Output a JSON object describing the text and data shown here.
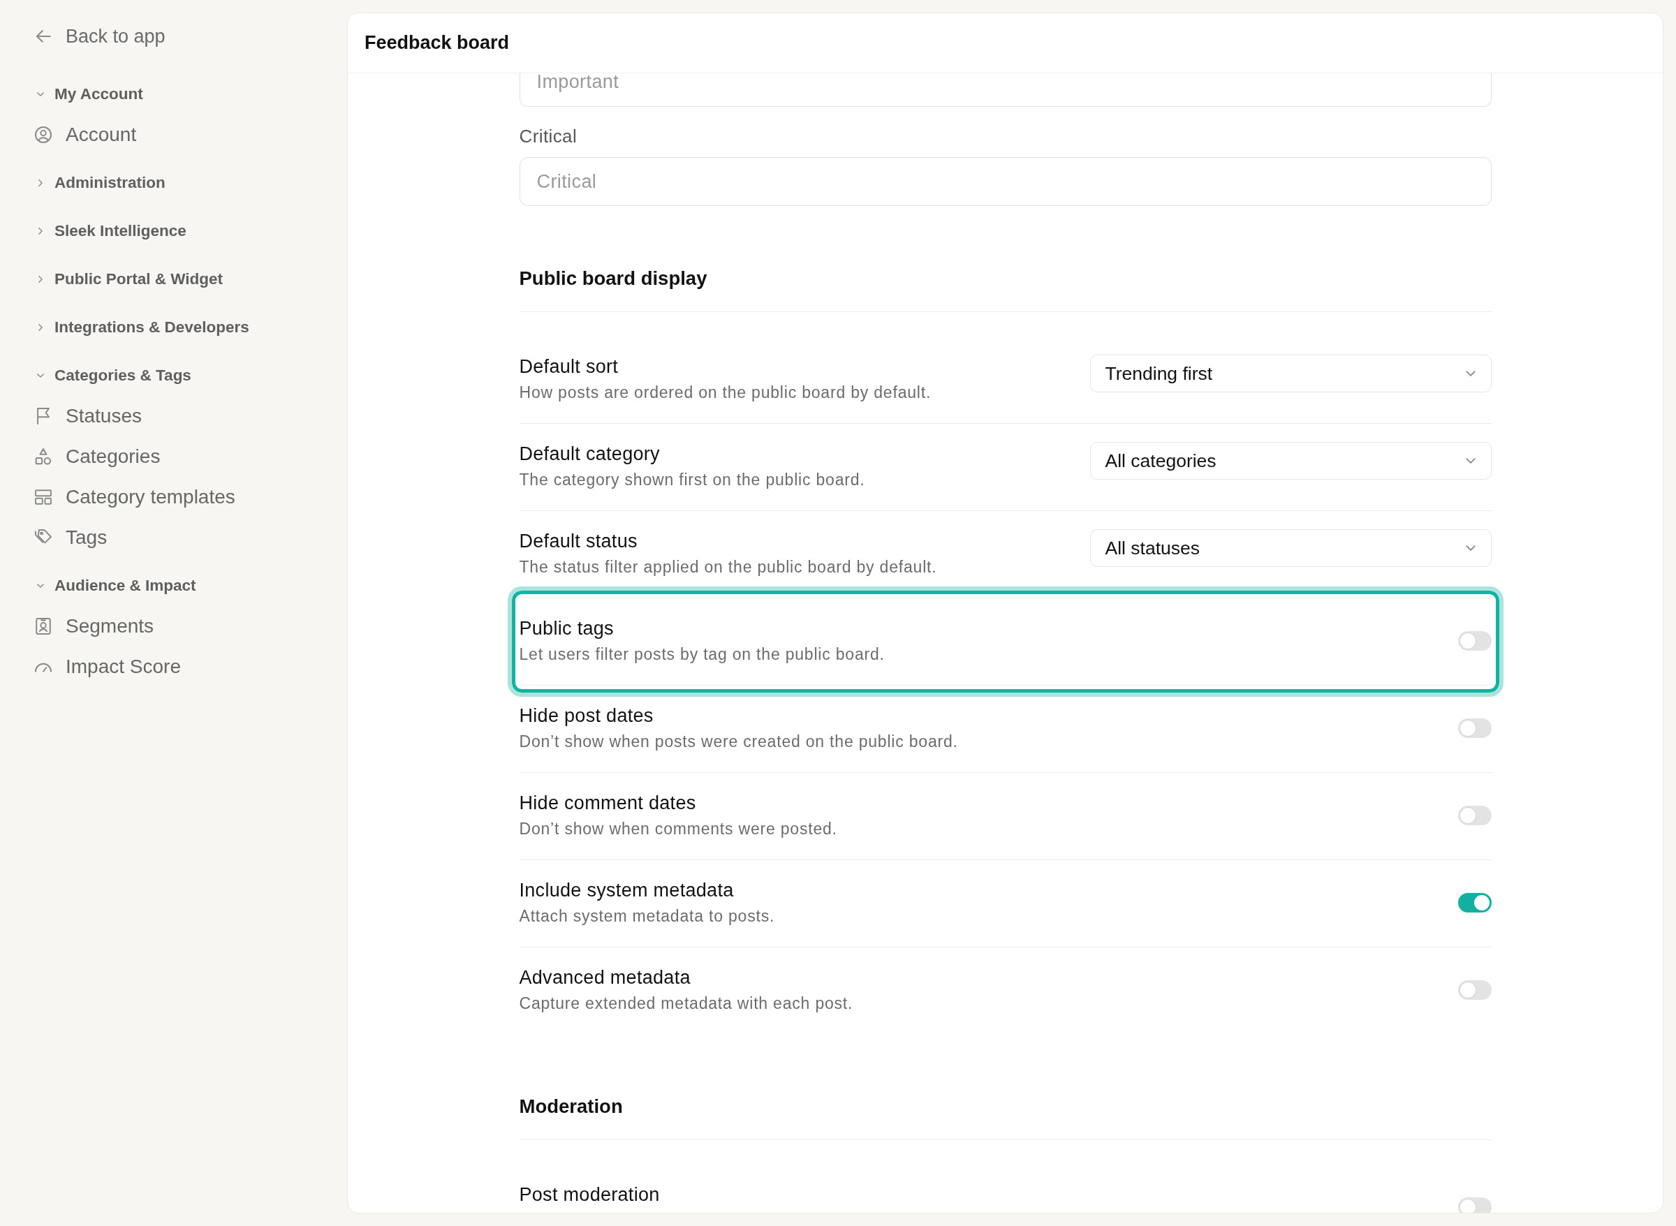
{
  "sidebar": {
    "back_link": "Back to app",
    "groups": [
      {
        "label": "My Account",
        "expanded": true,
        "items": [
          {
            "label": "Account",
            "selected": false
          }
        ]
      },
      {
        "label": "Administration",
        "expanded": false
      },
      {
        "label": "Sleek Intelligence",
        "expanded": false
      },
      {
        "label": "Public Portal & Widget",
        "expanded": false
      },
      {
        "label": "Integrations & Developers",
        "expanded": false
      },
      {
        "label": "Categories & Tags",
        "expanded": true,
        "items": [
          {
            "label": "Statuses",
            "selected": false
          },
          {
            "label": "Categories",
            "selected": false
          },
          {
            "label": "Category templates",
            "selected": false
          },
          {
            "label": "Tags",
            "selected": false
          }
        ]
      },
      {
        "label": "Audience & Impact",
        "expanded": true,
        "items": [
          {
            "label": "Segments",
            "selected": false
          },
          {
            "label": "Impact Score",
            "selected": false
          }
        ]
      }
    ]
  },
  "header": {
    "title": "Feedback board"
  },
  "content": {
    "fields": [
      {
        "placeholder": "Important"
      },
      {
        "label": "Critical",
        "placeholder": "Critical"
      }
    ],
    "sections": [
      {
        "title": "Public board display",
        "rows": [
          {
            "kind": "select",
            "title": "Default sort",
            "description": "How posts are ordered on the public board by default.",
            "value": "Trending first",
            "highlighted": false
          },
          {
            "kind": "select",
            "title": "Default category",
            "description": "The category shown first on the public board.",
            "value": "All categories",
            "highlighted": false
          },
          {
            "kind": "select",
            "title": "Default status",
            "description": "The status filter applied on the public board by default.",
            "value": "All statuses",
            "highlighted": false
          },
          {
            "kind": "toggle",
            "title": "Public tags",
            "description": "Let users filter posts by tag on the public board.",
            "on": false,
            "highlighted": true
          },
          {
            "kind": "toggle",
            "title": "Hide post dates",
            "description": "Don’t show when posts were created on the public board.",
            "on": false,
            "highlighted": false
          },
          {
            "kind": "toggle",
            "title": "Hide comment dates",
            "description": "Don’t show when comments were posted.",
            "on": false,
            "highlighted": false
          },
          {
            "kind": "toggle",
            "title": "Include system metadata",
            "description": "Attach system metadata to posts.",
            "on": true,
            "highlighted": false
          },
          {
            "kind": "toggle",
            "title": "Advanced metadata",
            "description": "Capture extended metadata with each post.",
            "on": false,
            "highlighted": false
          }
        ]
      },
      {
        "title": "Moderation",
        "rows": [
          {
            "kind": "toggle",
            "title": "Post moderation",
            "on": false,
            "highlighted": false
          }
        ]
      }
    ]
  }
}
